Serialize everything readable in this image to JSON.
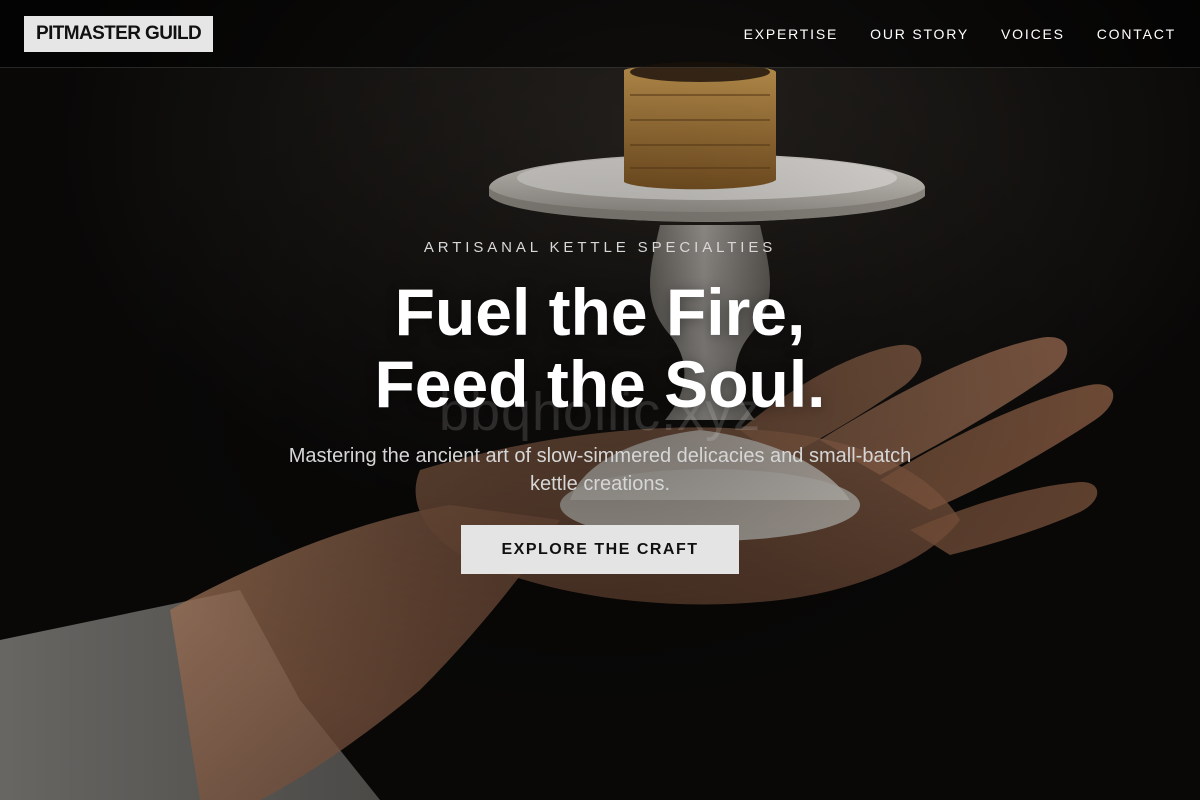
{
  "brand": {
    "name": "PITMASTER GUILD"
  },
  "nav": {
    "items": [
      {
        "label": "EXPERTISE"
      },
      {
        "label": "OUR STORY"
      },
      {
        "label": "VOICES"
      },
      {
        "label": "CONTACT"
      }
    ]
  },
  "hero": {
    "eyebrow": "ARTISANAL KETTLE SPECIALTIES",
    "headline_line1": "Fuel the Fire,",
    "headline_line2": "Feed the Soul.",
    "watermark": "bbqhollic.xyz",
    "subtitle": "Mastering the ancient art of slow-simmered delicacies and small-batch kettle creations.",
    "cta_label": "EXPLORE THE CRAFT"
  },
  "colors": {
    "background": "#0b0a09",
    "text": "#ffffff",
    "muted_text": "#d6d6d6",
    "button_bg": "#e4e4e4",
    "button_text": "#111111",
    "logo_bg": "#e6e6e6"
  },
  "image": {
    "subject": "hand-holding-pedestal-plate-with-pastry"
  }
}
